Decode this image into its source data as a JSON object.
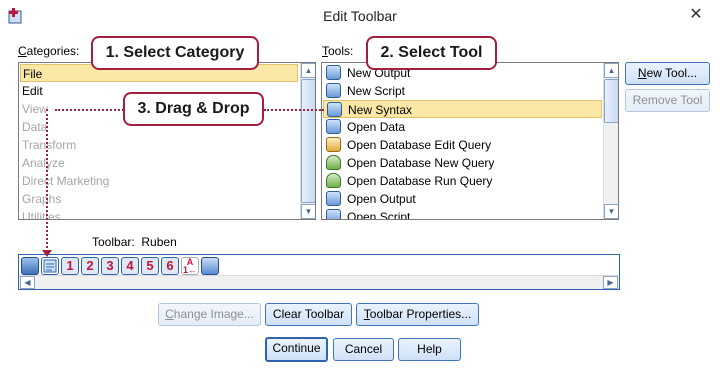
{
  "window": {
    "title": "Edit Toolbar",
    "close_glyph": "✕"
  },
  "categories": {
    "label_prefix": "C",
    "label_rest": "ategories:",
    "items": [
      {
        "label": "File",
        "state": "selected"
      },
      {
        "label": "Edit",
        "state": "enabled"
      },
      {
        "label": "View",
        "state": "disabled"
      },
      {
        "label": "Data",
        "state": "disabled"
      },
      {
        "label": "Transform",
        "state": "disabled"
      },
      {
        "label": "Analyze",
        "state": "disabled"
      },
      {
        "label": "Direct Marketing",
        "state": "disabled"
      },
      {
        "label": "Graphs",
        "state": "disabled"
      },
      {
        "label": "Utilities",
        "state": "disabled"
      }
    ]
  },
  "tools": {
    "label_prefix": "T",
    "label_rest": "ools:",
    "items": [
      {
        "label": "New Output",
        "icon": "output-icon"
      },
      {
        "label": "New Script",
        "icon": "script-icon"
      },
      {
        "label": "New Syntax",
        "icon": "syntax-icon",
        "selected": true
      },
      {
        "label": "Open Data",
        "icon": "data-icon"
      },
      {
        "label": "Open Database Edit Query",
        "icon": "database-edit-icon"
      },
      {
        "label": "Open Database New Query",
        "icon": "database-new-icon"
      },
      {
        "label": "Open Database Run Query",
        "icon": "database-run-icon"
      },
      {
        "label": "Open Output",
        "icon": "output-icon"
      },
      {
        "label": "Open Script",
        "icon": "script-icon"
      }
    ]
  },
  "side_buttons": {
    "new_tool_prefix": "N",
    "new_tool_rest": "ew Tool...",
    "remove_tool": "Remove Tool"
  },
  "toolbar": {
    "label": "Toolbar:",
    "name": "Ruben",
    "numbers": [
      "1",
      "2",
      "3",
      "4",
      "5",
      "6"
    ],
    "sort_glyph_top": "A",
    "sort_glyph_bottom": "1←"
  },
  "bottom_buttons": {
    "change_image_prefix": "C",
    "change_image_rest": "hange Image...",
    "clear_toolbar": "Clear Toolbar",
    "toolbar_properties_prefix": "T",
    "toolbar_properties_rest": "oolbar Properties...",
    "continue": "Continue",
    "cancel": "Cancel",
    "help": "Help"
  },
  "annotations": {
    "step1": "1. Select Category",
    "step2": "2. Select Tool",
    "step3": "3. Drag & Drop"
  },
  "colors": {
    "annotation": "#a41e3e",
    "selection": "#fbe8a6",
    "button_border": "#3f74c0"
  }
}
